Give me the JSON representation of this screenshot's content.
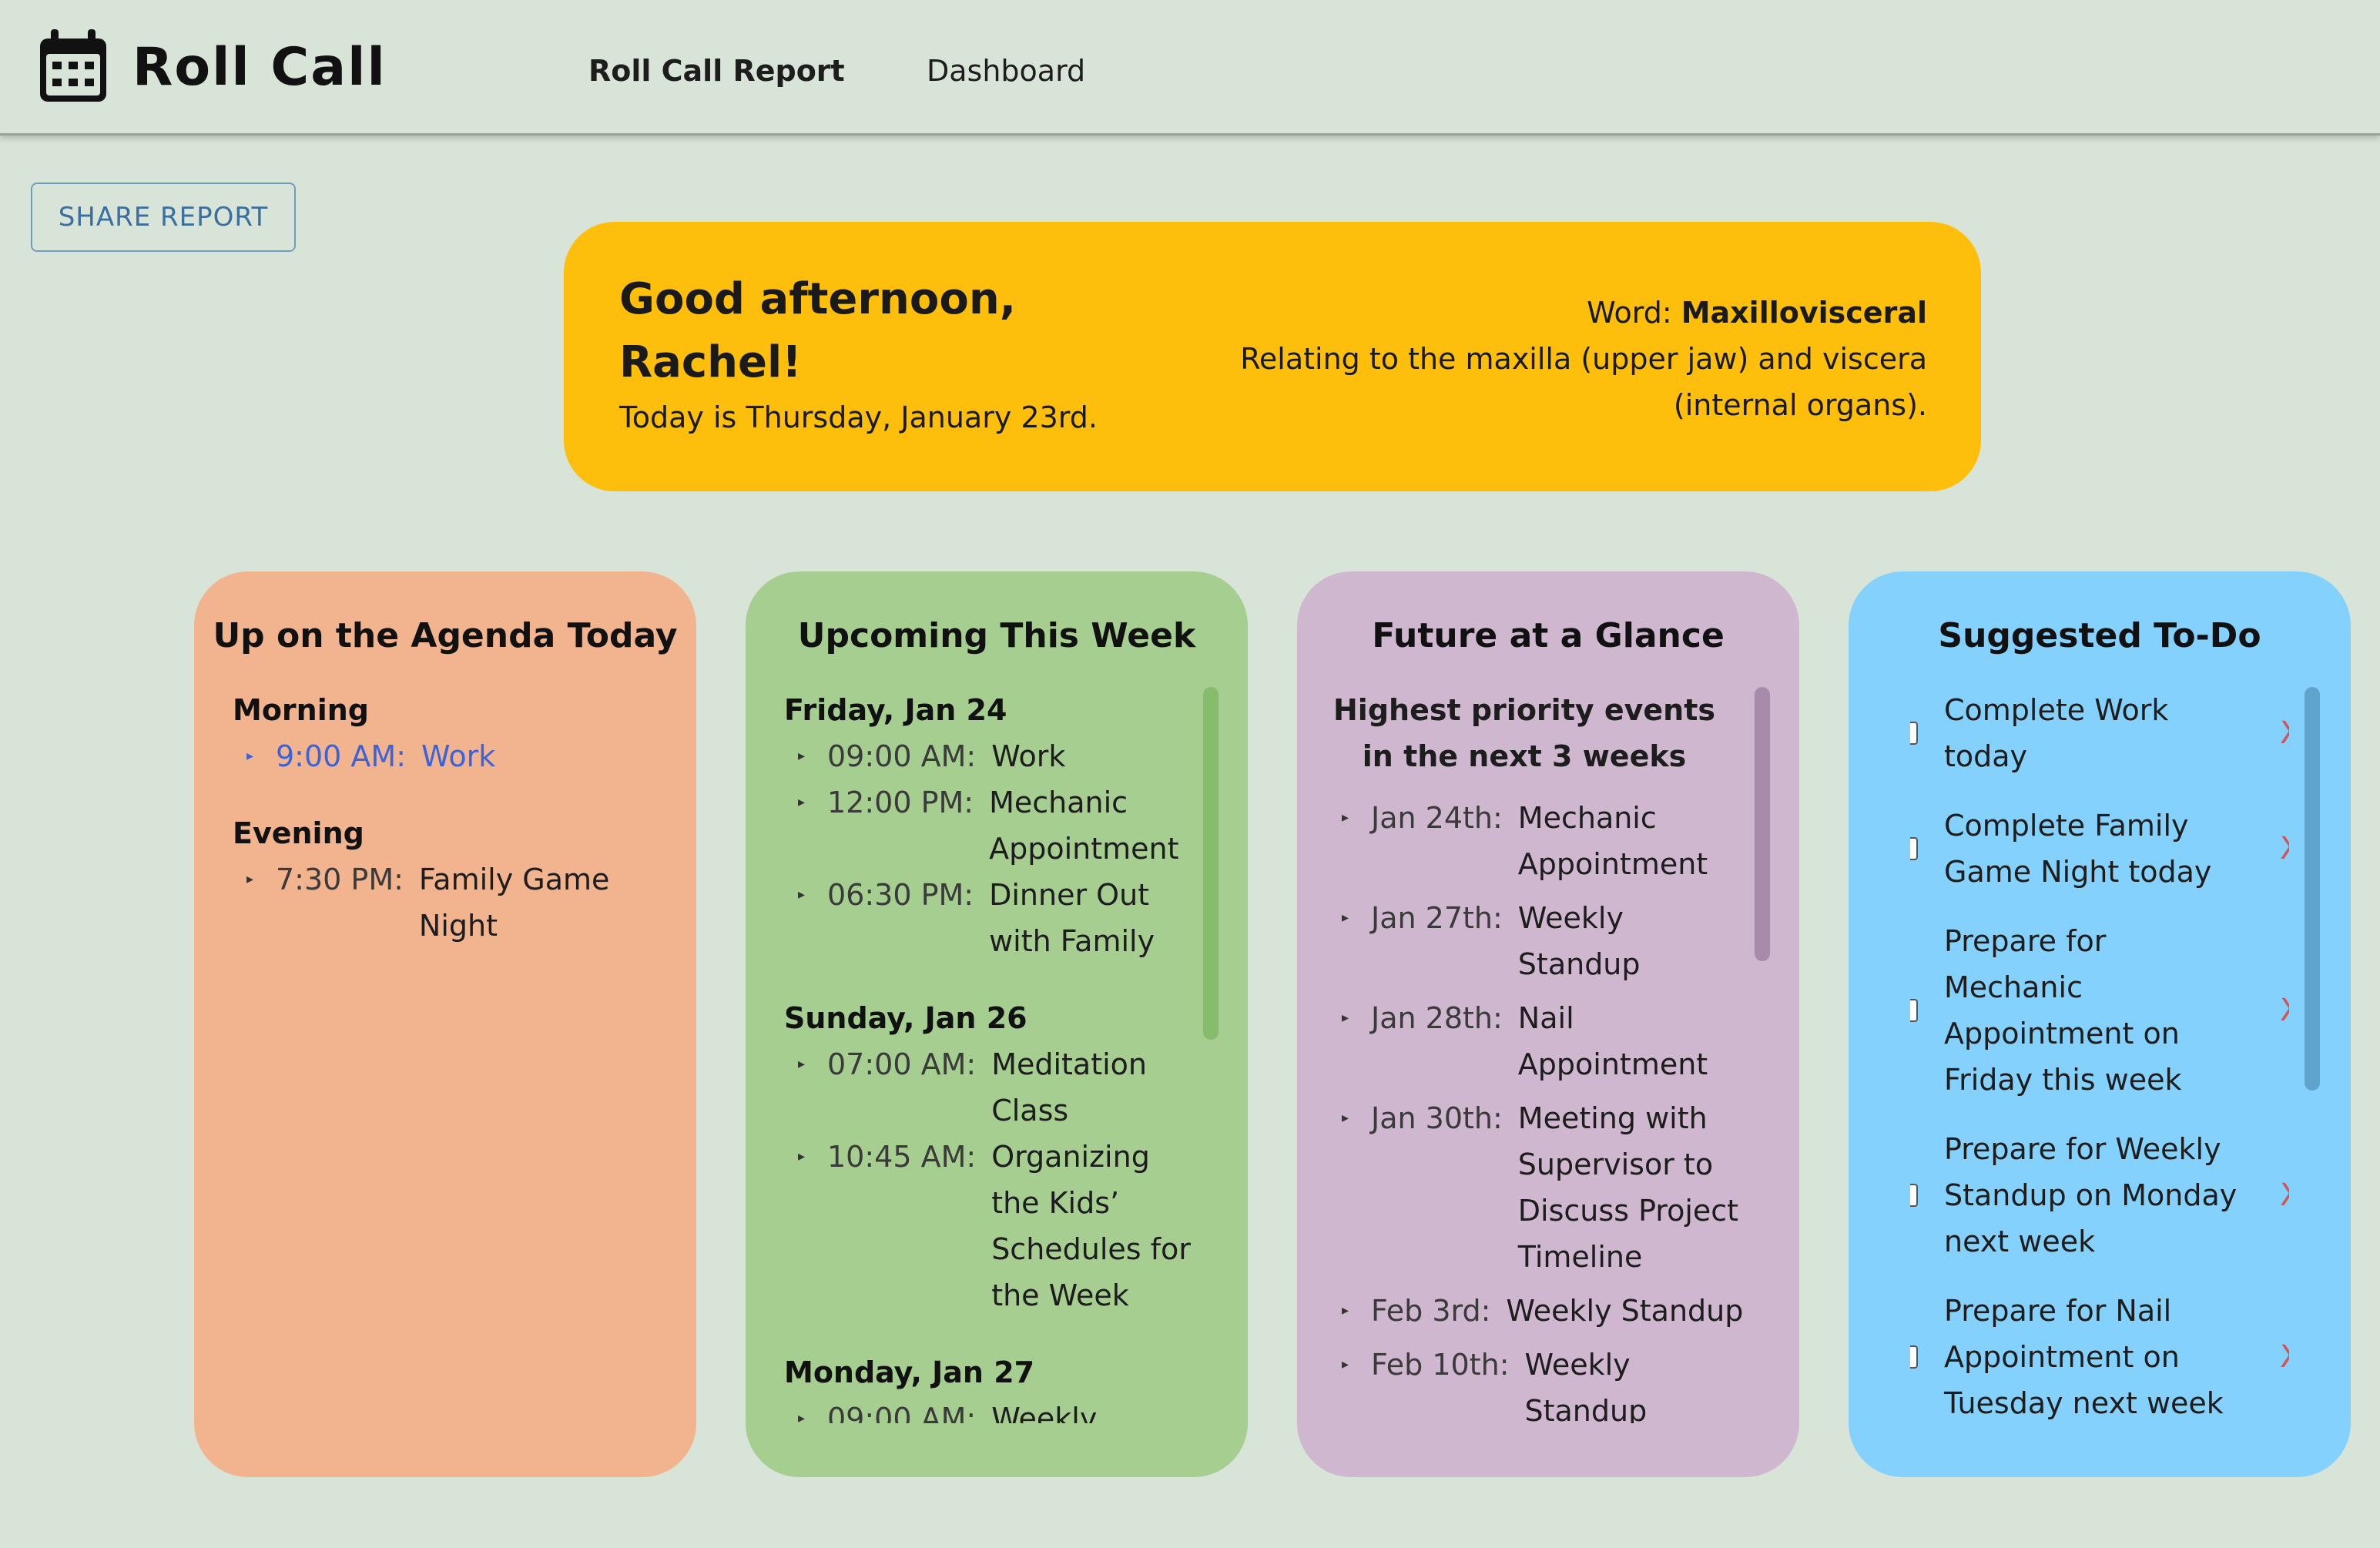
{
  "app": {
    "title": "Roll Call",
    "icon": "calendar-icon"
  },
  "nav": {
    "report": "Roll Call Report",
    "dashboard": "Dashboard"
  },
  "share_button": "SHARE REPORT",
  "banner": {
    "greeting_line1": "Good afternoon,",
    "greeting_line2": "Rachel!",
    "today": "Today is Thursday, January 23rd.",
    "word_label": "Word: ",
    "word": "Maxillovisceral",
    "definition": "Relating to the maxilla (upper jaw) and viscera (internal organs)."
  },
  "agenda": {
    "title": "Up on the Agenda Today",
    "sections": [
      {
        "label": "Morning",
        "events": [
          {
            "time": "9:00 AM:",
            "title": "Work"
          }
        ]
      },
      {
        "label": "Evening",
        "events": [
          {
            "time": "7:30 PM:",
            "title": "Family Game Night"
          }
        ]
      }
    ]
  },
  "week": {
    "title": "Upcoming This Week",
    "days": [
      {
        "label": "Friday, Jan 24",
        "events": [
          {
            "time": "09:00 AM:",
            "title": "Work"
          },
          {
            "time": "12:00 PM:",
            "title": "Mechanic Appointment"
          },
          {
            "time": "06:30 PM:",
            "title": "Dinner Out with Family"
          }
        ]
      },
      {
        "label": "Sunday, Jan 26",
        "events": [
          {
            "time": "07:00 AM:",
            "title": "Meditation Class"
          },
          {
            "time": "10:45 AM:",
            "title": "Organizing the Kids’ Schedules for the Week"
          }
        ]
      },
      {
        "label": "Monday, Jan 27",
        "events": [
          {
            "time": "09:00 AM:",
            "title": "Weekly"
          }
        ]
      }
    ]
  },
  "future": {
    "title": "Future at a Glance",
    "subtitle": "Highest priority events in the next 3 weeks",
    "events": [
      {
        "date": "Jan 24th:",
        "title": "Mechanic Appointment"
      },
      {
        "date": "Jan 27th:",
        "title": "Weekly Standup"
      },
      {
        "date": "Jan 28th:",
        "title": "Nail Appointment"
      },
      {
        "date": "Jan 30th:",
        "title": "Meeting with Supervisor to Discuss Project Timeline"
      },
      {
        "date": "Feb 3rd:",
        "title": "Weekly Standup"
      },
      {
        "date": "Feb 10th:",
        "title": "Weekly Standup"
      }
    ]
  },
  "todo": {
    "title": "Suggested To-Do",
    "remove_label": "X",
    "items": [
      "Complete Work today",
      "Complete Family Game Night today",
      "Prepare for Mechanic Appointment on Friday this week",
      "Prepare for Weekly Standup on Monday next week",
      "Prepare for Nail Appointment on Tuesday next week"
    ]
  },
  "colors": {
    "background": "#d9e4d8",
    "banner": "#febf0c",
    "agenda_card": "#f2b38f",
    "week_card": "#a5ce90",
    "future_card": "#cfb8cf",
    "todo_card": "#84d1fd",
    "link_blue": "#3c63d8",
    "remove_red": "#d0555a"
  }
}
